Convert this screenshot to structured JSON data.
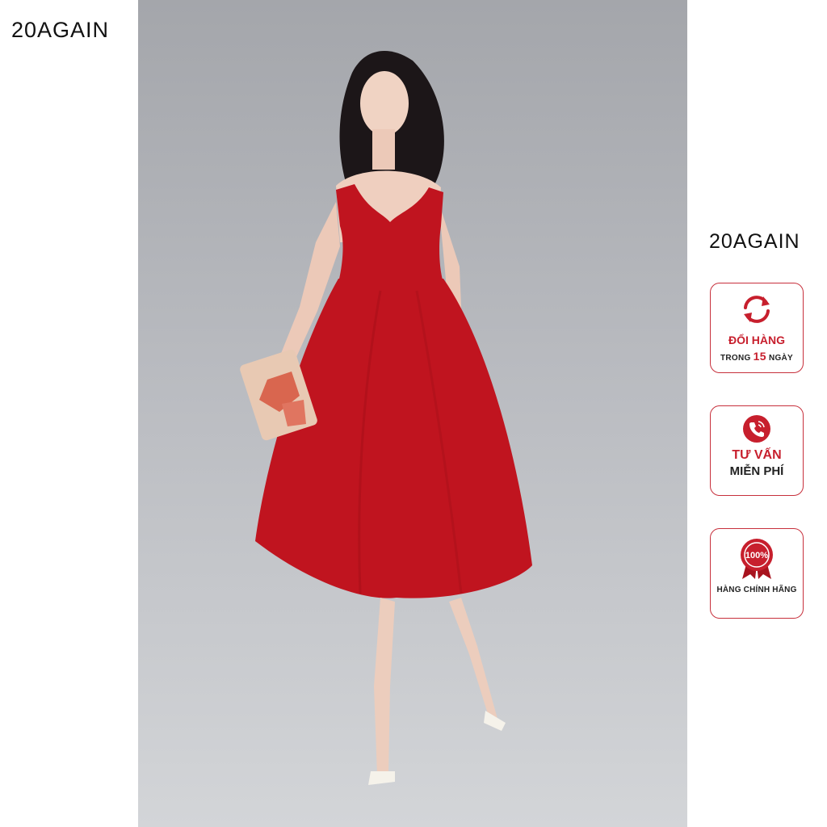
{
  "brand": {
    "top_logo": "20AGAIN",
    "side_logo": "20AGAIN"
  },
  "product_photo": {
    "subject": "Model in red midi dress holding patterned clutch"
  },
  "badges": [
    {
      "icon": "exchange-arrows-icon",
      "line1": "ĐỔI HÀNG",
      "line2_pre": "TRONG",
      "line2_num": "15",
      "line2_post": "NGÀY"
    },
    {
      "icon": "phone-call-icon",
      "line1": "TƯ VẤN",
      "line2": "MIỄN PHÍ"
    },
    {
      "icon": "authentic-seal-icon",
      "seal_text": "100%",
      "line1": "HÀNG CHÍNH HÃNG"
    }
  ],
  "colors": {
    "accent": "#c71f2d",
    "dress": "#c0141f",
    "backdrop": "#b9bbc0"
  }
}
